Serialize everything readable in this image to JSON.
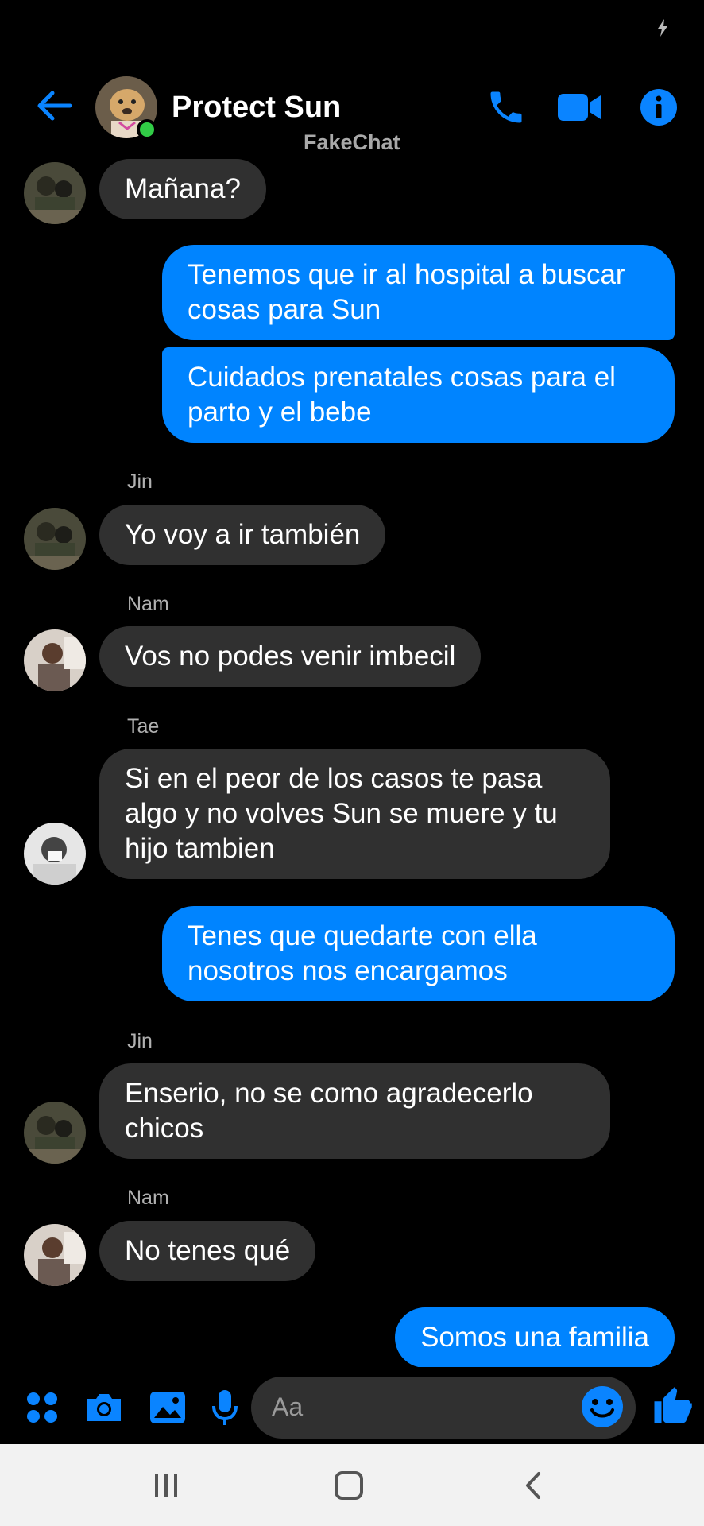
{
  "header": {
    "title": "Protect Sun",
    "watermark": "FakeChat"
  },
  "messages": [
    {
      "side": "in",
      "sender": "",
      "text": "Mañana?"
    },
    {
      "side": "out",
      "text": "Tenemos que ir al hospital a buscar cosas para Sun"
    },
    {
      "side": "out",
      "text": "Cuidados prenatales cosas para el parto y el bebe"
    },
    {
      "side": "in",
      "sender": "Jin",
      "text": "Yo voy a ir también"
    },
    {
      "side": "in",
      "sender": "Nam",
      "text": "Vos no podes venir imbecil"
    },
    {
      "side": "in",
      "sender": "Tae",
      "text": "Si en el peor de los casos te pasa algo y no volves Sun se muere y tu hijo tambien"
    },
    {
      "side": "out",
      "text": "Tenes que quedarte con ella nosotros nos encargamos"
    },
    {
      "side": "in",
      "sender": "Jin",
      "text": "Enserio, no se como agradecerlo chicos"
    },
    {
      "side": "in",
      "sender": "Nam",
      "text": "No tenes qué"
    },
    {
      "side": "out",
      "text": "Somos una familia"
    }
  ],
  "composer": {
    "placeholder": "Aa"
  },
  "icons": {
    "back": "arrow-left-icon",
    "call": "phone-icon",
    "video": "video-camera-icon",
    "info": "info-icon",
    "menu": "four-dots-icon",
    "camera": "camera-icon",
    "gallery": "image-icon",
    "mic": "microphone-icon",
    "emoji": "smiley-icon",
    "like": "thumbs-up-icon"
  },
  "colors": {
    "accent": "#0084ff",
    "incoming_bubble": "#303030",
    "background": "#000000",
    "online": "#31cc46"
  }
}
